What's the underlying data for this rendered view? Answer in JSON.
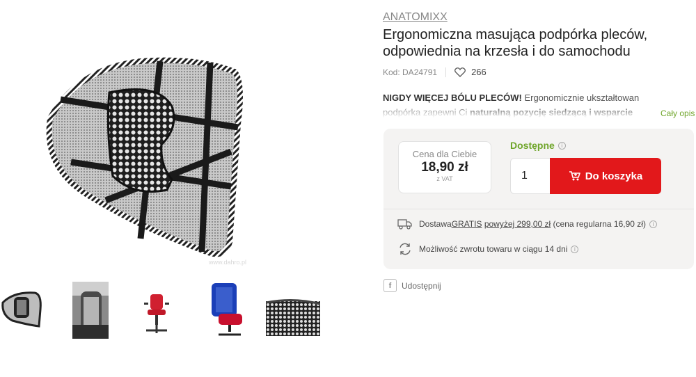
{
  "product": {
    "brand": "ANATOMIXX",
    "title": "Ergonomiczna masująca podpórka pleców, odpowiednia na krzesła i do samochodu",
    "code_label": "Kod: DA24791",
    "likes": "266",
    "watermark": "www.dahro.pl"
  },
  "description": {
    "part1": "NIGDY WIĘCEJ BÓLU PLECÓW!",
    "part2": " Ergonomicznie ukształtowan podpórka zapewni Ci ",
    "part3": "naturalną pozycję siedzącą i wsparcie pleców w o",
    "part4": "k",
    "more_link": "Cały opis"
  },
  "purchase": {
    "price_label": "Cena dla Ciebie",
    "price": "18,90 zł",
    "vat": "z VAT",
    "availability": "Dostępne",
    "info_glyph": "i",
    "quantity": "1",
    "cart_button": "Do koszyka"
  },
  "shipping": {
    "prefix": "Dostawa ",
    "gratis": "GRATIS",
    "mid": " ",
    "threshold": "powyżej 299,00 zł",
    "suffix": " (cena regularna 16,90 zł)",
    "returns": "Możliwość zwrotu towaru w ciągu 14 dni"
  },
  "share": {
    "label": "Udostępnij",
    "icon_glyph": "f"
  },
  "colors": {
    "accent_green": "#6fa52a",
    "cart_red": "#e2181b",
    "panel_bg": "#f4f3f2"
  },
  "icons": [
    "heart-icon",
    "cart-icon",
    "truck-icon",
    "return-icon",
    "info-icon",
    "facebook-icon"
  ]
}
